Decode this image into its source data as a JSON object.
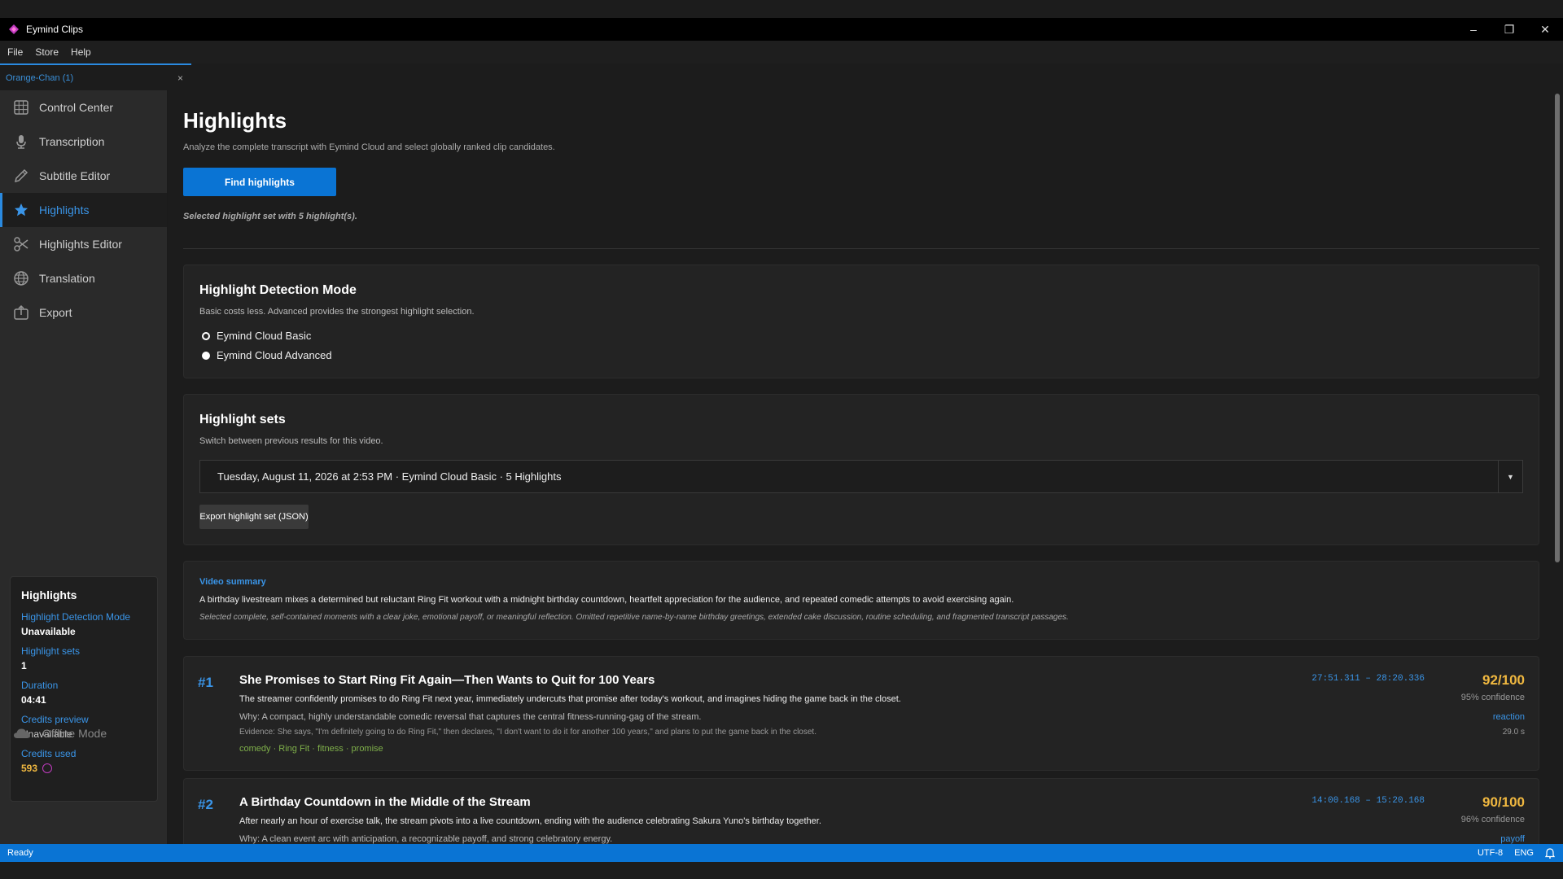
{
  "app": {
    "title": "Eymind Clips"
  },
  "menu": {
    "items": [
      "File",
      "Store",
      "Help"
    ]
  },
  "tab": {
    "label": "Orange-Chan (1)",
    "close": "×"
  },
  "sidebar": {
    "items": [
      {
        "label": "Control Center",
        "icon": "grid-icon"
      },
      {
        "label": "Transcription",
        "icon": "microphone-icon"
      },
      {
        "label": "Subtitle Editor",
        "icon": "pencil-icon"
      },
      {
        "label": "Highlights",
        "icon": "star-icon",
        "active": true
      },
      {
        "label": "Highlights Editor",
        "icon": "scissors-icon"
      },
      {
        "label": "Translation",
        "icon": "globe-icon"
      },
      {
        "label": "Export",
        "icon": "export-icon"
      }
    ],
    "info": {
      "title": "Highlights",
      "fields": [
        {
          "label": "Highlight Detection Mode",
          "value": "Unavailable"
        },
        {
          "label": "Highlight sets",
          "value": "1"
        },
        {
          "label": "Duration",
          "value": "04:41"
        },
        {
          "label": "Credits preview",
          "value": "Unavailable"
        },
        {
          "label": "Credits used",
          "value": "593"
        }
      ]
    },
    "offline_label": "Offline Mode"
  },
  "main": {
    "title": "Highlights",
    "description": "Analyze the complete transcript with Eymind Cloud and select globally ranked clip candidates.",
    "find_button": "Find highlights",
    "status": "Selected highlight set with 5 highlight(s).",
    "detection": {
      "title": "Highlight Detection Mode",
      "description": "Basic costs less. Advanced provides the strongest highlight selection.",
      "options": [
        "Eymind Cloud Basic",
        "Eymind Cloud Advanced"
      ]
    },
    "sets": {
      "title": "Highlight sets",
      "description": "Switch between previous results for this video.",
      "selected": "Tuesday, August 11, 2026 at 2:53 PM  ·  Eymind Cloud Basic  ·  5 Highlights",
      "export_button": "Export highlight set (JSON)"
    },
    "summary": {
      "label": "Video summary",
      "text": "A birthday livestream mixes a determined but reluctant Ring Fit workout with a midnight birthday countdown, heartfelt appreciation for the audience, and repeated comedic attempts to avoid exercising again.",
      "note": "Selected complete, self-contained moments with a clear joke, emotional payoff, or meaningful reflection. Omitted repetitive name-by-name birthday greetings, extended cake discussion, routine scheduling, and fragmented transcript passages."
    },
    "highlights": [
      {
        "rank": "#1",
        "title": "She Promises to Start Ring Fit Again—Then Wants to Quit for 100 Years",
        "description": "The streamer confidently promises to do Ring Fit next year, immediately undercuts that promise after today's workout, and imagines hiding the game back in the closet.",
        "why": "Why: A compact, highly understandable comedic reversal that captures the central fitness-running-gag of the stream.",
        "evidence": "Evidence: She says, \"I'm definitely going to do Ring Fit,\" then declares, \"I don't want to do it for another 100 years,\" and plans to put the game back in the closet.",
        "tags": "comedy · Ring Fit · fitness · promise",
        "time": "27:51.311 – 28:20.336",
        "score": "92/100",
        "confidence": "95% confidence",
        "type": "reaction",
        "duration": "29.0 s"
      },
      {
        "rank": "#2",
        "title": "A Birthday Countdown in the Middle of the Stream",
        "description": "After nearly an hour of exercise talk, the stream pivots into a live countdown, ending with the audience celebrating Sakura Yuno's birthday together.",
        "why": "Why: A clean event arc with anticipation, a recognizable payoff, and strong celebratory energy.",
        "time": "14:00.168 – 15:20.168",
        "score": "90/100",
        "confidence": "96% confidence",
        "type": "payoff"
      }
    ]
  },
  "statusbar": {
    "left": "Ready",
    "encoding": "UTF-8",
    "language": "ENG"
  },
  "colors": {
    "accent": "#0a74d4",
    "link": "#3a95e8",
    "score": "#f0b840",
    "tags": "#7fb04a",
    "coin": "#c03bbf"
  }
}
